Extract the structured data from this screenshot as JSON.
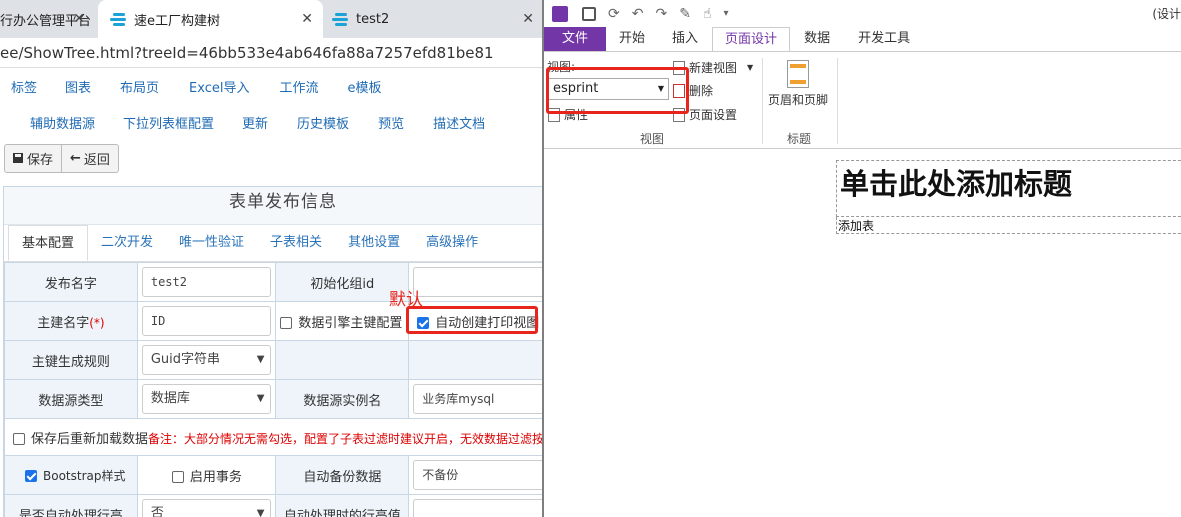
{
  "browser": {
    "tabs": [
      {
        "label": "行办公管理平台"
      },
      {
        "label": "速e工厂构建树"
      },
      {
        "label": "test2"
      }
    ],
    "close_glyph": "✕",
    "url": "ee/ShowTree.html?treeId=46bb533e4ab646fa88a7257efd81be81"
  },
  "menu_primary": [
    "标签",
    "图表",
    "布局页",
    "Excel导入",
    "工作流",
    "e模板"
  ],
  "menu_secondary": [
    "辅助数据源",
    "下拉列表框配置",
    "更新",
    "历史模板",
    "预览",
    "描述文档"
  ],
  "toolbar": {
    "save_label": "保存",
    "back_label": "返回"
  },
  "form": {
    "title": "表单发布信息",
    "tabs": [
      "基本配置",
      "二次开发",
      "唯一性验证",
      "子表相关",
      "其他设置",
      "高级操作"
    ],
    "publish_name_label": "发布名字",
    "publish_name_value": "test2",
    "init_group_id_label": "初始化组id",
    "primary_key_label": "主建名字",
    "required_mark": "(*)",
    "primary_key_value": "ID",
    "engine_pk_label": "数据引擎主键配置",
    "auto_print_label": "自动创建打印视图",
    "default_annotation": "默认",
    "pk_rule_label": "主键生成规则",
    "pk_rule_value": "Guid字符串",
    "ds_type_label": "数据源类型",
    "ds_type_value": "数据库",
    "ds_instance_label": "数据源实例名",
    "ds_instance_value": "业务库mysql",
    "reload_label": "保存后重新加载数据",
    "reload_note": "备注：大部分情况无需勾选，配置了子表过滤时建议开启，无效数据过滤按需",
    "bootstrap_label": "Bootstrap样式",
    "transaction_label": "启用事务",
    "auto_backup_label": "自动备份数据",
    "auto_backup_value": "不备份",
    "auto_row_height_label": "是否自动处理行高",
    "auto_row_height_value": "否",
    "row_height_value_label": "自动处理时的行高值"
  },
  "office": {
    "corner_text": "(设计",
    "tabs": [
      "文件",
      "开始",
      "插入",
      "页面设计",
      "数据",
      "开发工具"
    ],
    "view_label": "视图:",
    "view_value": "esprint",
    "new_view": "新建视图",
    "delete": "删除",
    "properties": "属性",
    "page_setup": "页面设置",
    "group_view": "视图",
    "header_footer": "页眉和页脚",
    "group_title": "标题",
    "page_title_placeholder": "单击此处添加标题",
    "add_table": "添加表"
  },
  "colors": {
    "accent_red": "#e8251c",
    "onenote_purple": "#7336a6",
    "link_blue": "#1f6bb5"
  }
}
